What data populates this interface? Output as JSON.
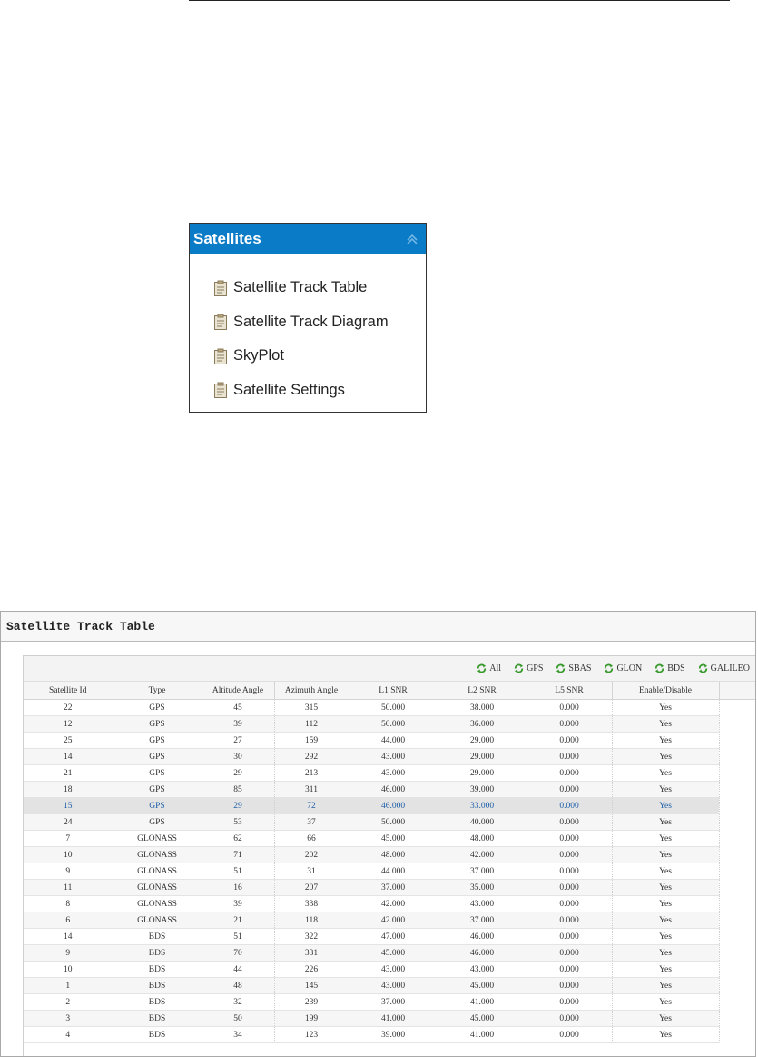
{
  "menu": {
    "title": "Satellites",
    "items": [
      {
        "label": "Satellite Track Table"
      },
      {
        "label": "Satellite Track Diagram"
      },
      {
        "label": "SkyPlot"
      },
      {
        "label": "Satellite Settings"
      }
    ]
  },
  "track_table": {
    "title": "Satellite Track Table",
    "filters": [
      "All",
      "GPS",
      "SBAS",
      "GLON",
      "BDS",
      "GALILEO"
    ],
    "columns": [
      "Satellite Id",
      "Type",
      "Altitude Angle",
      "Azimuth Angle",
      "L1 SNR",
      "L2 SNR",
      "L5 SNR",
      "Enable/Disable"
    ],
    "selected_row": 6,
    "rows": [
      [
        "22",
        "GPS",
        "45",
        "315",
        "50.000",
        "38.000",
        "0.000",
        "Yes"
      ],
      [
        "12",
        "GPS",
        "39",
        "112",
        "50.000",
        "36.000",
        "0.000",
        "Yes"
      ],
      [
        "25",
        "GPS",
        "27",
        "159",
        "44.000",
        "29.000",
        "0.000",
        "Yes"
      ],
      [
        "14",
        "GPS",
        "30",
        "292",
        "43.000",
        "29.000",
        "0.000",
        "Yes"
      ],
      [
        "21",
        "GPS",
        "29",
        "213",
        "43.000",
        "29.000",
        "0.000",
        "Yes"
      ],
      [
        "18",
        "GPS",
        "85",
        "311",
        "46.000",
        "39.000",
        "0.000",
        "Yes"
      ],
      [
        "15",
        "GPS",
        "29",
        "72",
        "46.000",
        "33.000",
        "0.000",
        "Yes"
      ],
      [
        "24",
        "GPS",
        "53",
        "37",
        "50.000",
        "40.000",
        "0.000",
        "Yes"
      ],
      [
        "7",
        "GLONASS",
        "62",
        "66",
        "45.000",
        "48.000",
        "0.000",
        "Yes"
      ],
      [
        "10",
        "GLONASS",
        "71",
        "202",
        "48.000",
        "42.000",
        "0.000",
        "Yes"
      ],
      [
        "9",
        "GLONASS",
        "51",
        "31",
        "44.000",
        "37.000",
        "0.000",
        "Yes"
      ],
      [
        "11",
        "GLONASS",
        "16",
        "207",
        "37.000",
        "35.000",
        "0.000",
        "Yes"
      ],
      [
        "8",
        "GLONASS",
        "39",
        "338",
        "42.000",
        "43.000",
        "0.000",
        "Yes"
      ],
      [
        "6",
        "GLONASS",
        "21",
        "118",
        "42.000",
        "37.000",
        "0.000",
        "Yes"
      ],
      [
        "14",
        "BDS",
        "51",
        "322",
        "47.000",
        "46.000",
        "0.000",
        "Yes"
      ],
      [
        "9",
        "BDS",
        "70",
        "331",
        "45.000",
        "46.000",
        "0.000",
        "Yes"
      ],
      [
        "10",
        "BDS",
        "44",
        "226",
        "43.000",
        "43.000",
        "0.000",
        "Yes"
      ],
      [
        "1",
        "BDS",
        "48",
        "145",
        "43.000",
        "45.000",
        "0.000",
        "Yes"
      ],
      [
        "2",
        "BDS",
        "32",
        "239",
        "37.000",
        "41.000",
        "0.000",
        "Yes"
      ],
      [
        "3",
        "BDS",
        "50",
        "199",
        "41.000",
        "45.000",
        "0.000",
        "Yes"
      ],
      [
        "4",
        "BDS",
        "34",
        "123",
        "39.000",
        "41.000",
        "0.000",
        "Yes"
      ]
    ]
  },
  "colors": {
    "header_blue": "#0a7bc6",
    "selected_text": "#1f5fa8",
    "refresh_icon_green": "#3a9a2e"
  },
  "icons": {
    "menu_item": "clipboard-icon",
    "header": "double-chevron-up-icon",
    "filter": "refresh-icon"
  }
}
